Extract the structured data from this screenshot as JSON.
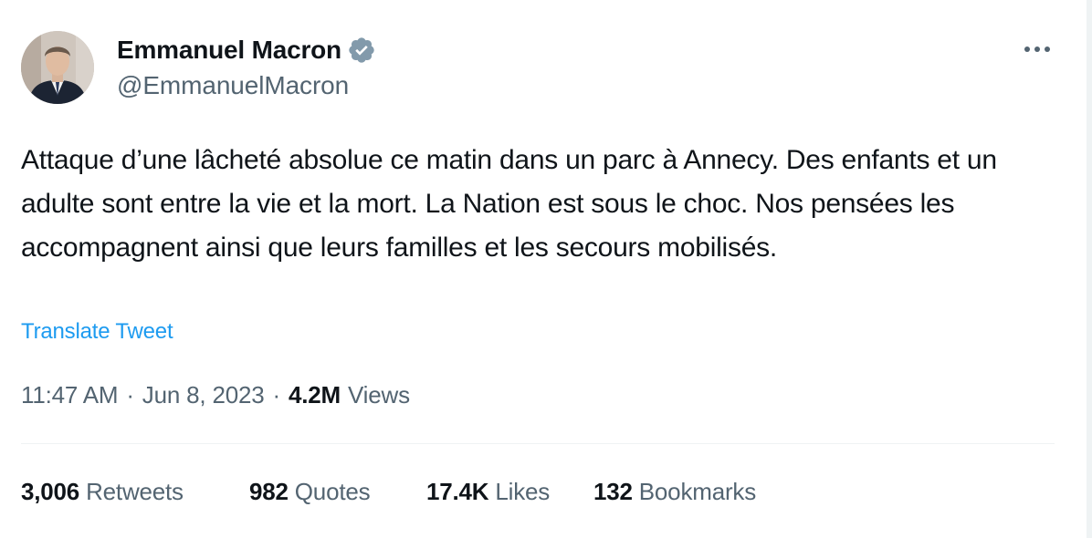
{
  "tweet": {
    "author": {
      "name": "Emmanuel Macron",
      "handle": "@EmmanuelMacron",
      "verified": true,
      "avatar_icon": "profile-photo"
    },
    "more_icon": "more-dots-icon",
    "text": "Attaque d’une lâcheté absolue ce matin dans un parc à Annecy. Des enfants et un adulte sont entre la vie et la mort. La Nation est sous le choc. Nos pensées les accompagnent ainsi que leurs familles et les secours mobilisés.",
    "translate_label": "Translate Tweet",
    "time": "11:47 AM",
    "separator": "·",
    "date": "Jun 8, 2023",
    "views_count": "4.2M",
    "views_label": "Views",
    "stats": {
      "retweets": {
        "count": "3,006",
        "label": "Retweets"
      },
      "quotes": {
        "count": "982",
        "label": "Quotes"
      },
      "likes": {
        "count": "17.4K",
        "label": "Likes"
      },
      "bookmarks": {
        "count": "132",
        "label": "Bookmarks"
      }
    }
  },
  "colors": {
    "text_primary": "#0f1419",
    "text_secondary": "#536471",
    "link": "#1d9bf0",
    "verified_badge": "#829aab",
    "divider": "#eff3f4"
  }
}
